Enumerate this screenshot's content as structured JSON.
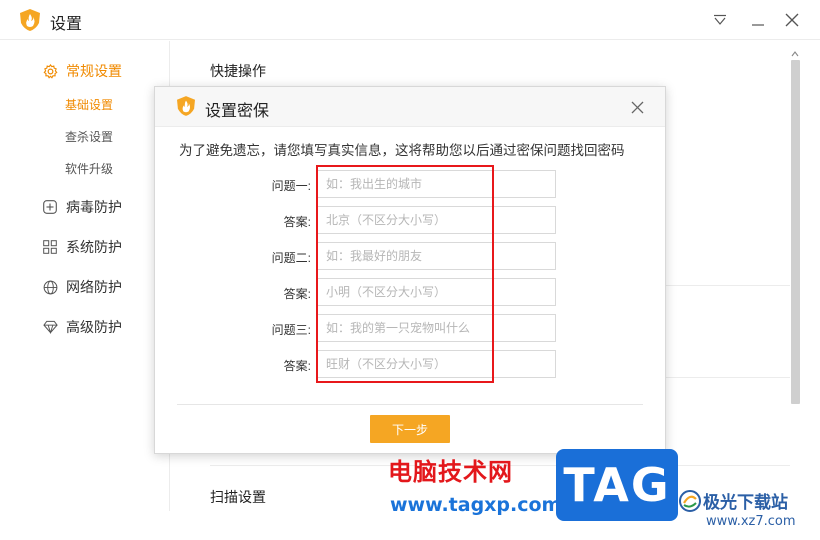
{
  "window": {
    "title": "设置",
    "controls": [
      "dropdown-icon",
      "minimize-icon",
      "close-icon"
    ]
  },
  "sidebar": {
    "groups": [
      {
        "label": "常规设置",
        "icon": "gear-icon",
        "active": true,
        "items": [
          {
            "label": "基础设置",
            "active": true
          },
          {
            "label": "查杀设置",
            "active": false
          },
          {
            "label": "软件升级",
            "active": false
          }
        ]
      },
      {
        "label": "病毒防护",
        "icon": "plus-square-icon",
        "active": false
      },
      {
        "label": "系统防护",
        "icon": "windows-icon",
        "active": false
      },
      {
        "label": "网络防护",
        "icon": "globe-icon",
        "active": false
      },
      {
        "label": "高级防护",
        "icon": "diamond-icon",
        "active": false
      }
    ]
  },
  "main": {
    "sections": [
      "快捷操作",
      "扫描设置"
    ]
  },
  "dialog": {
    "title": "设置密保",
    "description": "为了避免遗忘，请您填写真实信息，这将帮助您以后通过密保问题找回密码",
    "rows": [
      {
        "label": "问题一:",
        "placeholder": "如：我出生的城市",
        "value": ""
      },
      {
        "label": "答案:",
        "placeholder": "北京（不区分大小写）",
        "value": ""
      },
      {
        "label": "问题二:",
        "placeholder": "如：我最好的朋友",
        "value": ""
      },
      {
        "label": "答案:",
        "placeholder": "小明（不区分大小写）",
        "value": ""
      },
      {
        "label": "问题三:",
        "placeholder": "如：我的第一只宠物叫什么",
        "value": ""
      },
      {
        "label": "答案:",
        "placeholder": "旺财（不区分大小写）",
        "value": ""
      }
    ],
    "next_label": "下一步"
  },
  "watermarks": {
    "site_name": "电脑技术网",
    "site_url": "www.tagxp.com",
    "tag": "TAG",
    "xz_name": "极光下载站",
    "xz_url": "www.xz7.com"
  },
  "colors": {
    "accent": "#f08a00",
    "button": "#f5a623",
    "highlight": "#e8181b",
    "tag_blue": "#1a6fd8"
  }
}
